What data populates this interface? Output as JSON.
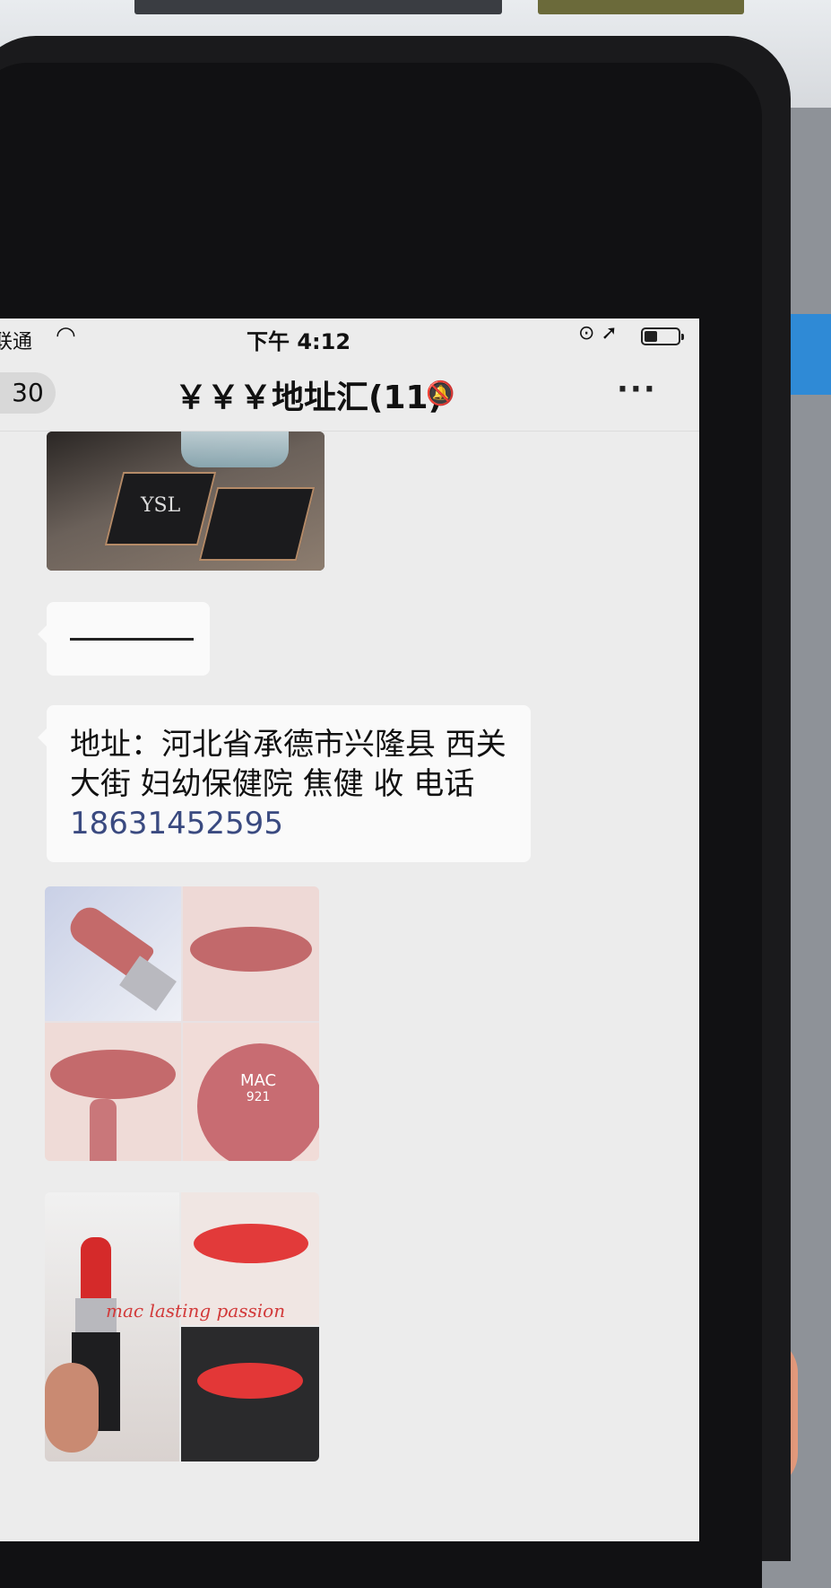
{
  "status_bar": {
    "carrier": "国联通",
    "wifi_icon": "wifi-icon",
    "time": "下午 4:12",
    "right_icons": "⊙ ➚"
  },
  "nav": {
    "back_count": "30",
    "title": "￥￥￥地址汇(11)",
    "mute_icon": "🔕",
    "more_label": "···"
  },
  "messages": [
    {
      "type": "image",
      "description_icon": "photo-ysl-palette"
    },
    {
      "type": "text",
      "text": "———————"
    },
    {
      "type": "text",
      "text": "地址：河北省承德市兴隆县 西关大街 妇幼保健院 焦健 收 电话",
      "phone": "18631452595"
    },
    {
      "type": "image",
      "brand": "MAC",
      "shade": "921"
    },
    {
      "type": "image",
      "overlay": "mac lasting passion"
    }
  ]
}
